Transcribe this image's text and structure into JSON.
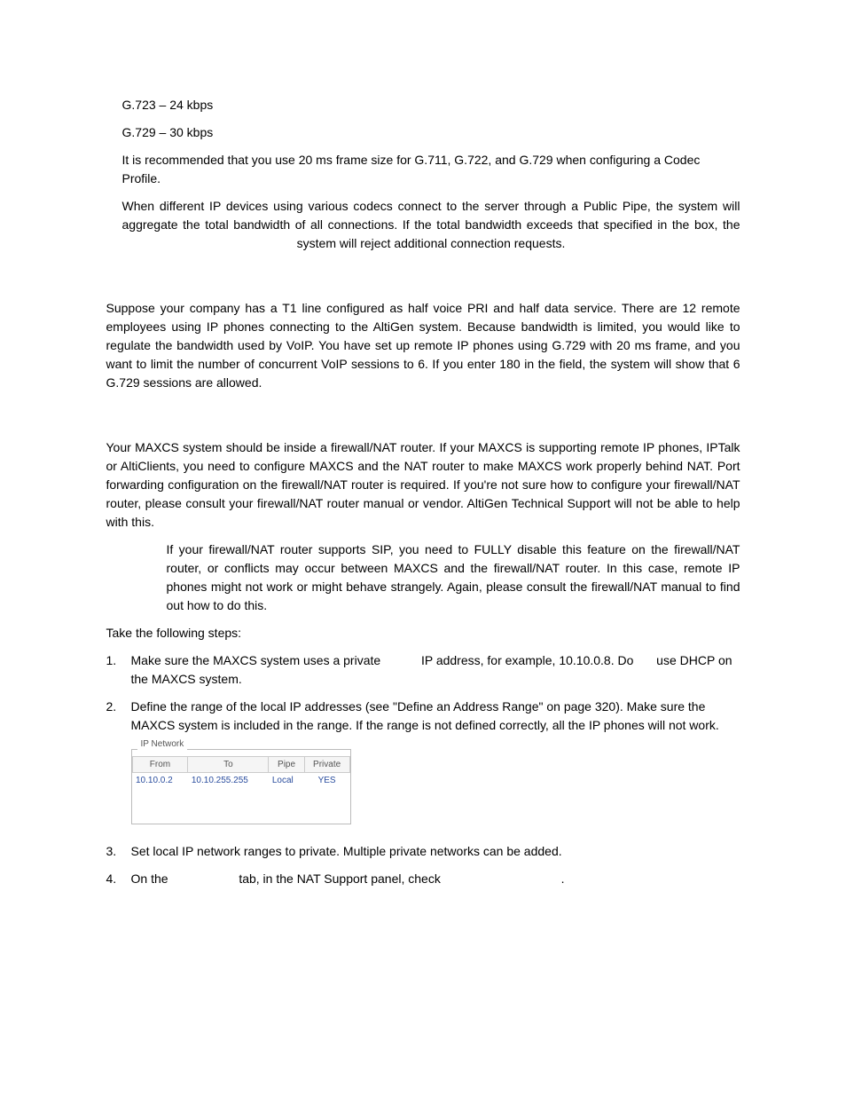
{
  "intro": {
    "line1": "G.723 – 24 kbps",
    "line2": "G.729 – 30 kbps",
    "para1": "It is recommended that you use 20 ms frame size for G.711, G.722, and G.729 when configuring a Codec Profile.",
    "para2": "When different IP devices using various codecs connect to the server through a Public Pipe, the system will aggregate the total bandwidth of all connections. If the total bandwidth exceeds that specified in the box, the system will reject additional connection requests."
  },
  "example_para": "Suppose your company has a T1 line configured as half voice PRI and half data service. There are 12 remote employees using IP phones connecting to the AltiGen system. Because bandwidth is limited, you would like to regulate the bandwidth used by VoIP. You have set up remote IP phones using G.729 with 20 ms frame, and you want to limit the number of concurrent VoIP sessions to 6. If you enter 180 in the                                             field, the system will show that 6 G.729 sessions are allowed.",
  "nat_para": "Your MAXCS system should be inside a firewall/NAT router. If your MAXCS is supporting remote IP phones, IPTalk or AltiClients, you need to configure MAXCS and the NAT router to make MAXCS work properly behind NAT. Port forwarding configuration on the firewall/NAT router is required. If you're not sure how to configure your firewall/NAT router, please consult your firewall/NAT router manual or vendor. AltiGen Technical Support will not be able to help with this.",
  "note_para": "If your firewall/NAT router supports SIP, you need to FULLY disable this feature on the firewall/NAT router, or conflicts may occur between MAXCS and the firewall/NAT router. In this case, remote IP phones might not work or might behave strangely. Again, please consult the firewall/NAT manual to find out how to do this.",
  "steps_intro": "Take the following steps:",
  "steps": {
    "s1_prefix": "Make sure the MAXCS system uses a private ",
    "s1_mid": "IP address, for example, 10.10.0.8. Do ",
    "s1_suffix": "use DHCP on the MAXCS system.",
    "s2": "Define the range of the local IP addresses (see \"Define an Address Range\" on page 320). Make sure the MAXCS system is included in the range. If the range is not defined correctly, all the IP phones will not work.",
    "s3": "Set local IP network ranges to private. Multiple private networks can be added.",
    "s4_prefix": "On the ",
    "s4_mid": "tab, in the NAT Support panel, check ",
    "s4_suffix": "."
  },
  "ip_network": {
    "legend": "IP Network",
    "headers": {
      "from": "From",
      "to": "To",
      "pipe": "Pipe",
      "private": "Private"
    },
    "row": {
      "from": "10.10.0.2",
      "to": "10.10.255.255",
      "pipe": "Local",
      "private": "YES"
    }
  },
  "markers": {
    "m1": "1.",
    "m2": "2.",
    "m3": "3.",
    "m4": "4."
  }
}
